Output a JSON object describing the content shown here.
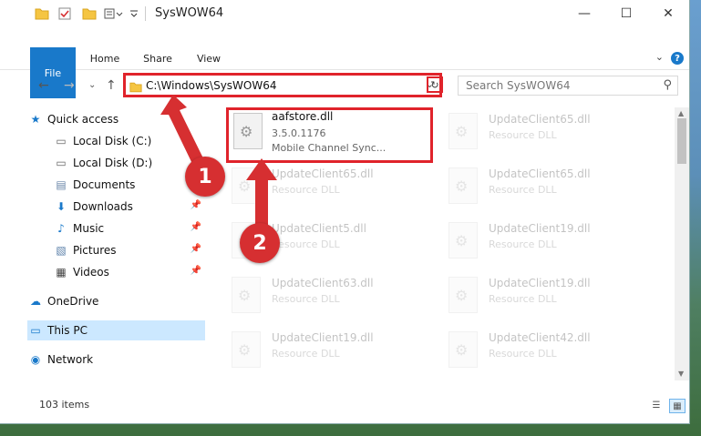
{
  "window": {
    "title": "SysWOW64"
  },
  "titlebar": {
    "minimize": "—",
    "maximize": "☐",
    "close": "✕"
  },
  "ribbon": {
    "tabs": [
      "File",
      "Home",
      "Share",
      "View"
    ],
    "help": "?",
    "collapse": "⌄"
  },
  "navbar": {
    "back": "←",
    "forward": "→",
    "recent": "⌄",
    "up": "↑",
    "address": "C:\\Windows\\SysWOW64",
    "dropdown": "⌄",
    "refresh": "↻",
    "search_placeholder": "Search SysWOW64"
  },
  "sidebar": {
    "items": [
      {
        "label": "Quick access",
        "icon": "★"
      },
      {
        "label": "Local Disk (C:)",
        "icon": "▭"
      },
      {
        "label": "Local Disk (D:)",
        "icon": "▭"
      },
      {
        "label": "Documents",
        "icon": "▤"
      },
      {
        "label": "Downloads",
        "icon": "⬇"
      },
      {
        "label": "Music",
        "icon": "♪"
      },
      {
        "label": "Pictures",
        "icon": "▧"
      },
      {
        "label": "Videos",
        "icon": "▦"
      },
      {
        "label": "OneDrive",
        "icon": "☁"
      },
      {
        "label": "This PC",
        "icon": "▭"
      },
      {
        "label": "Network",
        "icon": "◉"
      }
    ]
  },
  "files": [
    {
      "name": "aafstore.dll",
      "line2": "3.5.0.1176",
      "line3": "Mobile Channel Sync..."
    },
    {
      "name": "UpdateClient65.dll",
      "line2": "Resource DLL"
    },
    {
      "name": "UpdateClient65.dll",
      "line2": "Resource DLL"
    },
    {
      "name": "UpdateClient65.dll",
      "line2": "Resource DLL"
    },
    {
      "name": "UpdateClient5.dll",
      "line2": "Resource DLL"
    },
    {
      "name": "UpdateClient19.dll",
      "line2": "Resource DLL"
    },
    {
      "name": "UpdateClient63.dll",
      "line2": "Resource DLL"
    },
    {
      "name": "UpdateClient19.dll",
      "line2": "Resource DLL"
    },
    {
      "name": "UpdateClient19.dll",
      "line2": "Resource DLL"
    },
    {
      "name": "UpdateClient42.dll",
      "line2": "Resource DLL"
    }
  ],
  "status": {
    "count": "103 items"
  },
  "annotations": {
    "step1": "1",
    "step2": "2"
  },
  "colors": {
    "accent": "#1979ca",
    "highlight": "#e0232b",
    "badge": "#d62f31"
  }
}
